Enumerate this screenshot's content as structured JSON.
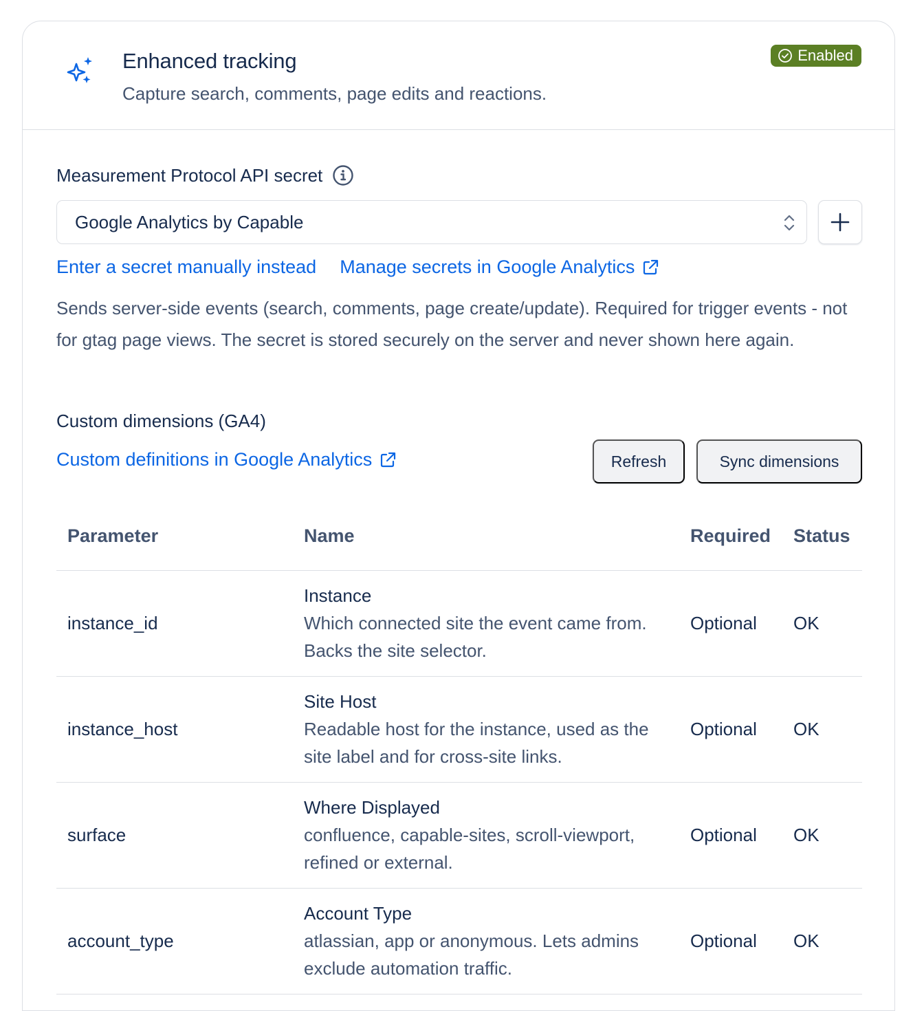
{
  "header": {
    "title": "Enhanced tracking",
    "subtitle": "Capture search, comments, page edits and reactions.",
    "status": "Enabled"
  },
  "secret": {
    "label": "Measurement Protocol API secret",
    "selected": "Google Analytics by Capable",
    "manual_link": "Enter a secret manually instead",
    "manage_link": "Manage secrets in Google Analytics",
    "help": "Sends server-side events (search, comments, page create/update). Required for trigger events - not for gtag page views. The secret is stored securely on the server and never shown here again."
  },
  "dimensions": {
    "label": "Custom dimensions (GA4)",
    "defs_link": "Custom definitions in Google Analytics",
    "refresh_label": "Refresh",
    "sync_label": "Sync dimensions",
    "columns": [
      "Parameter",
      "Name",
      "Required",
      "Status"
    ],
    "rows": [
      {
        "parameter": "instance_id",
        "name": "Instance",
        "description": "Which connected site the event came from. Backs the site selector.",
        "required": "Optional",
        "status": "OK"
      },
      {
        "parameter": "instance_host",
        "name": "Site Host",
        "description": "Readable host for the instance, used as the site label and for cross-site links.",
        "required": "Optional",
        "status": "OK"
      },
      {
        "parameter": "surface",
        "name": "Where Displayed",
        "description": "confluence, capable-sites, scroll-viewport, refined or external.",
        "required": "Optional",
        "status": "OK"
      },
      {
        "parameter": "account_type",
        "name": "Account Type",
        "description": "atlassian, app or anonymous. Lets admins exclude automation traffic.",
        "required": "Optional",
        "status": "OK"
      }
    ]
  },
  "colors": {
    "accent": "#0c66e4",
    "success": "#5b7f24",
    "ok_text": "#4c6b1f"
  }
}
